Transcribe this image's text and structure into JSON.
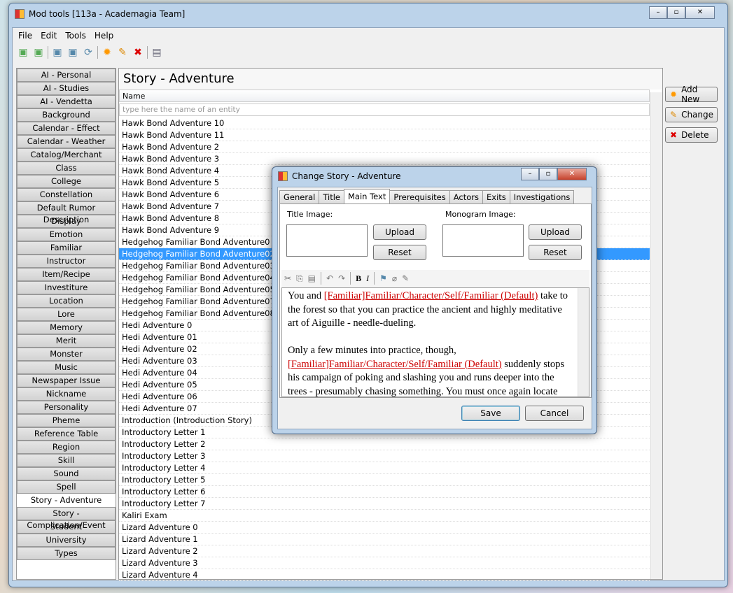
{
  "window": {
    "title": "Mod tools [113a - Academagia Team]"
  },
  "menu": [
    "File",
    "Edit",
    "Tools",
    "Help"
  ],
  "toolbar_icons": [
    "open-icon",
    "save-icon",
    "import-icon",
    "export-icon",
    "sync-icon",
    "new-icon",
    "edit-icon",
    "delete-icon",
    "properties-icon"
  ],
  "sidebar": [
    "AI - Personal",
    "AI - Studies",
    "AI - Vendetta",
    "Background",
    "Calendar - Effect",
    "Calendar - Weather",
    "Catalog/Merchant",
    "Class",
    "College",
    "Constellation",
    "Default Rumor Description",
    "Display",
    "Emotion",
    "Familiar",
    "Instructor",
    "Item/Recipe",
    "Investiture",
    "Location",
    "Lore",
    "Memory",
    "Merit",
    "Monster",
    "Music",
    "Newspaper Issue",
    "Nickname",
    "Personality",
    "Pheme",
    "Reference Table",
    "Region",
    "Skill",
    "Sound",
    "Spell",
    "Story - Adventure",
    "Story - Complication/Event",
    "Student",
    "University",
    "Types"
  ],
  "sidebar_selected": "Story - Adventure",
  "main": {
    "title": "Story - Adventure",
    "column": "Name",
    "filter_placeholder": "type here the name of an entity",
    "rows": [
      "Hawk Bond Adventure 10",
      "Hawk Bond Adventure 11",
      "Hawk Bond Adventure 2",
      "Hawk Bond Adventure 3",
      "Hawk Bond Adventure 4",
      "Hawk Bond Adventure 5",
      "Hawk Bond Adventure 6",
      "Hawk Bond Adventure 7",
      "Hawk Bond Adventure 8",
      "Hawk Bond Adventure 9",
      "Hedgehog Familiar Bond Adventure0",
      "Hedgehog Familiar Bond Adventure02",
      "Hedgehog Familiar Bond Adventure03",
      "Hedgehog Familiar Bond Adventure04",
      "Hedgehog Familiar Bond Adventure05",
      "Hedgehog Familiar Bond Adventure07",
      "Hedgehog Familiar Bond Adventure08",
      "Hedi Adventure 0",
      "Hedi Adventure 01",
      "Hedi Adventure 02",
      "Hedi Adventure 03",
      "Hedi Adventure 04",
      "Hedi Adventure 05",
      "Hedi Adventure 06",
      "Hedi Adventure 07",
      "Introduction (Introduction Story)",
      "Introductory Letter 1",
      "Introductory Letter 2",
      "Introductory Letter 3",
      "Introductory Letter 4",
      "Introductory Letter 5",
      "Introductory Letter 6",
      "Introductory Letter 7",
      "Kaliri Exam",
      "Lizard Adventure 0",
      "Lizard Adventure 1",
      "Lizard Adventure 2",
      "Lizard Adventure 3",
      "Lizard Adventure 4"
    ],
    "selected_row": "Hedgehog Familiar Bond Adventure02"
  },
  "actions": {
    "add": "Add New",
    "change": "Change",
    "delete": "Delete"
  },
  "dialog": {
    "title": "Change Story - Adventure",
    "tabs": [
      "General",
      "Title",
      "Main Text",
      "Prerequisites",
      "Actors",
      "Exits",
      "Investigations"
    ],
    "active_tab": "Main Text",
    "title_image": "Title Image:",
    "monogram_image": "Monogram Image:",
    "upload": "Upload",
    "reset": "Reset",
    "text": [
      [
        "You and ",
        ""
      ],
      [
        "[Familiar]Familiar/Character/Self/Familiar (Default)",
        "tag"
      ],
      [
        " take to the forest so that you can practice the ancient and highly meditative art of Aiguille - needle-dueling.",
        ""
      ],
      [
        "\n\nOnly a few minutes into practice, though, ",
        ""
      ],
      [
        "[Familiar]Familiar/Character/Self/Familiar (Default)",
        "tag"
      ],
      [
        " suddenly stops his campaign of poking and slashing you and runs deeper into the trees - presumably chasing something. You must once again locate",
        ""
      ]
    ],
    "save": "Save",
    "cancel": "Cancel"
  }
}
